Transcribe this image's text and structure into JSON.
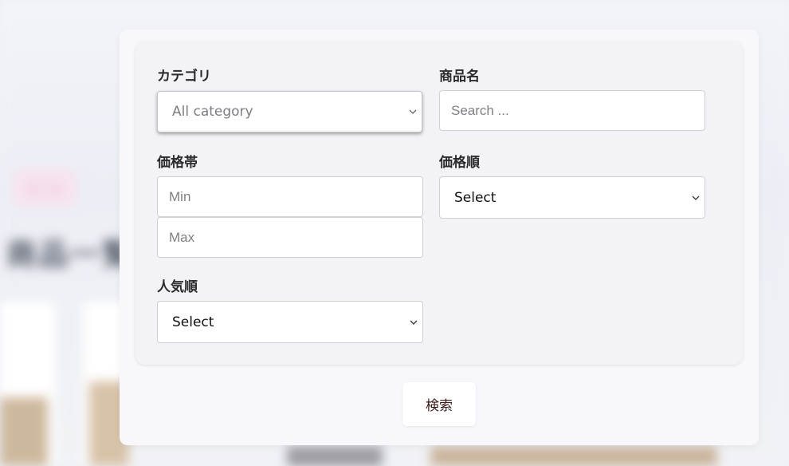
{
  "background": {
    "badge_text": "セール",
    "title_text": "商品一覧"
  },
  "filters": {
    "category": {
      "label": "カテゴリ",
      "selected": "All category"
    },
    "product_name": {
      "label": "商品名",
      "placeholder": "Search ..."
    },
    "price_range": {
      "label": "価格帯",
      "min_placeholder": "Min",
      "max_placeholder": "Max"
    },
    "price_order": {
      "label": "価格順",
      "selected": "Select"
    },
    "popularity_order": {
      "label": "人気順",
      "selected": "Select"
    }
  },
  "search_button": {
    "label": "検索"
  },
  "icons": {
    "dropdown": "chevron-down-icon"
  },
  "colors": {
    "popup_bg": "#f8f8fc",
    "card_bg": "#f3f3f7",
    "button_text": "#3a1a1a"
  }
}
